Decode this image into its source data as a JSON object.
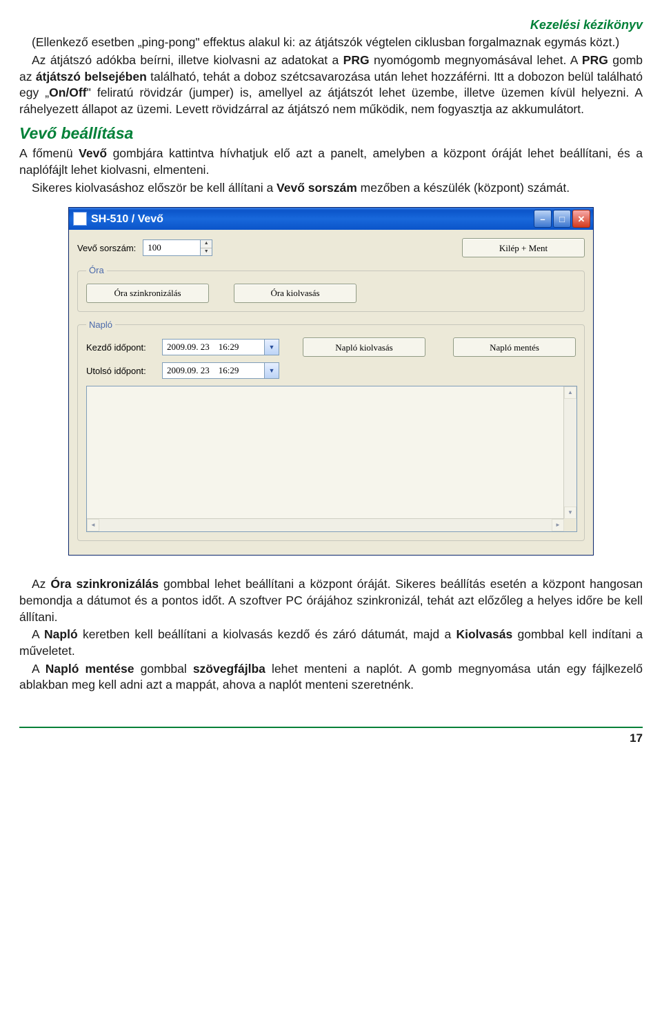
{
  "header": {
    "title": "Kezelési kézikönyv"
  },
  "para1": "(Ellenkező esetben „ping-pong\" effektus alakul ki: az átjátszók végtelen ciklusban forgalmaznak egymás közt.)",
  "para2a": "Az átjátszó adókba beírni, illetve kiolvasni az adatokat a ",
  "para2b": "PRG",
  "para2c": " nyomógomb megnyomásával lehet. A ",
  "para2d": "PRG",
  "para2e": " gomb az ",
  "para2f": "átjátszó belsejében",
  "para2g": " található, tehát a doboz szétcsavarozása után lehet hozzáférni. Itt a dobozon belül található egy „",
  "para2h": "On/Off",
  "para2i": "\" feliratú rövidzár (jumper) is, amellyel az átjátszót lehet üzembe, illetve üzemen kívül helyezni. A ráhelyezett állapot az üzemi. Levett rövidzárral az átjátszó nem működik, nem fogyasztja az akkumulátort.",
  "section_title": "Vevő beállítása",
  "vevo_p1a": "A főmenü ",
  "vevo_p1b": "Vevő",
  "vevo_p1c": " gombjára kattintva hívhatjuk elő azt a panelt, amelyben a központ óráját lehet beállítani, és a naplófájlt lehet kiolvasni, elmenteni.",
  "vevo_p2a": "Sikeres kiolvasáshoz először be kell állítani a ",
  "vevo_p2b": "Vevő sorszám",
  "vevo_p2c": " mezőben a készülék (központ) számát.",
  "window": {
    "title": "SH-510 / Vevő",
    "sorszam_label": "Vevő sorszám:",
    "sorszam_value": "100",
    "exit_save": "Kilép + Ment",
    "ora_legend": "Óra",
    "ora_sync": "Óra szinkronizálás",
    "ora_read": "Óra kiolvasás",
    "naplo_legend": "Napló",
    "kezdo_label": "Kezdő időpont:",
    "kezdo_value": "2009.09. 23    16:29",
    "utolso_label": "Utolsó időpont:",
    "utolso_value": "2009.09. 23    16:29",
    "naplo_read": "Napló kiolvasás",
    "naplo_save": "Napló mentés"
  },
  "after1a": "Az ",
  "after1b": "Óra szinkronizálás",
  "after1c": " gombbal lehet beállítani a központ óráját. Sikeres beállítás esetén a központ hangosan bemondja a dátumot és a pontos időt. A szoftver PC órájához szinkronizál, tehát azt előzőleg a helyes időre be kell állítani.",
  "after2a": "A ",
  "after2b": "Napló",
  "after2c": " keretben kell beállítani a kiolvasás kezdő és záró dátumát, majd a ",
  "after2d": "Kiolvasás",
  "after2e": " gombbal kell indítani a műveletet.",
  "after3a": "A ",
  "after3b": "Napló mentése",
  "after3c": " gombbal ",
  "after3d": "szövegfájlba",
  "after3e": " lehet menteni a naplót. A gomb megnyomása után egy fájlkezelő ablakban meg kell adni azt a mappát, ahova a naplót menteni szeretnénk.",
  "page_number": "17"
}
